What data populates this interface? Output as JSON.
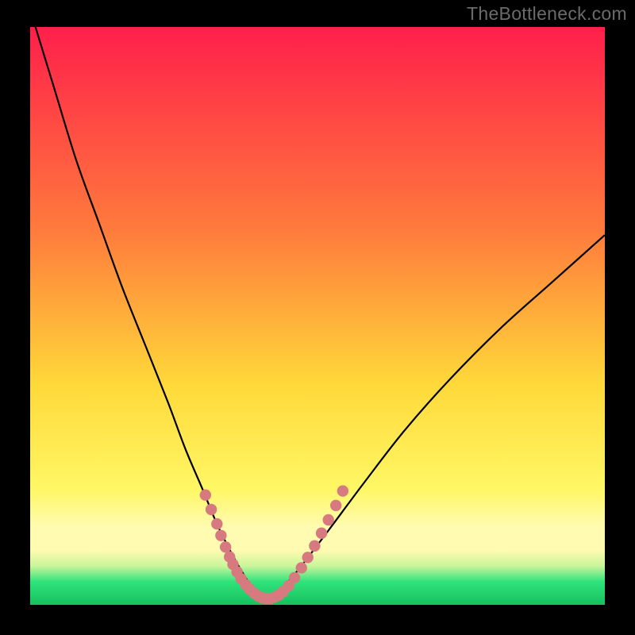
{
  "watermark": "TheBottleneck.com",
  "colors": {
    "black": "#000000",
    "curve": "#000000",
    "marker_fill": "#d77a7f",
    "grad_top": "#ff1f4b",
    "grad_mid1": "#ff7a3c",
    "grad_mid2": "#ffd93a",
    "grad_band": "#fffbb0",
    "grad_green_light": "#c9f59a",
    "grad_green": "#2fe37b",
    "grad_green_dark": "#17c060"
  },
  "chart_data": {
    "type": "line",
    "title": "",
    "xlabel": "",
    "ylabel": "",
    "xlim": [
      0,
      100
    ],
    "ylim": [
      0,
      100
    ],
    "series": [
      {
        "name": "bottleneck-curve",
        "x": [
          0,
          4,
          8,
          12,
          16,
          20,
          24,
          27,
          30,
          32.5,
          35,
          37,
          39,
          40.5,
          42,
          44,
          47,
          52,
          58,
          65,
          73,
          82,
          91,
          100
        ],
        "y": [
          103,
          90,
          77,
          66,
          55,
          45,
          35,
          27,
          20,
          14,
          9,
          5.5,
          2.5,
          1.2,
          1.3,
          3.0,
          6.5,
          13,
          21,
          30,
          39,
          48,
          56,
          64
        ]
      }
    ],
    "markers": {
      "name": "highlight-points",
      "points": [
        [
          30.5,
          19.0
        ],
        [
          31.5,
          16.5
        ],
        [
          32.5,
          14.0
        ],
        [
          33.2,
          12.0
        ],
        [
          34.0,
          10.0
        ],
        [
          34.7,
          8.3
        ],
        [
          35.3,
          7.0
        ],
        [
          36.0,
          5.7
        ],
        [
          36.7,
          4.5
        ],
        [
          37.5,
          3.5
        ],
        [
          38.2,
          2.7
        ],
        [
          39.0,
          2.0
        ],
        [
          39.7,
          1.5
        ],
        [
          40.4,
          1.2
        ],
        [
          41.1,
          1.1
        ],
        [
          41.8,
          1.1
        ],
        [
          42.5,
          1.3
        ],
        [
          43.3,
          1.7
        ],
        [
          44.0,
          2.3
        ],
        [
          45.0,
          3.3
        ],
        [
          46.0,
          4.7
        ],
        [
          47.2,
          6.4
        ],
        [
          48.3,
          8.2
        ],
        [
          49.5,
          10.2
        ],
        [
          50.7,
          12.4
        ],
        [
          51.9,
          14.7
        ],
        [
          53.2,
          17.2
        ],
        [
          54.4,
          19.7
        ]
      ]
    }
  }
}
